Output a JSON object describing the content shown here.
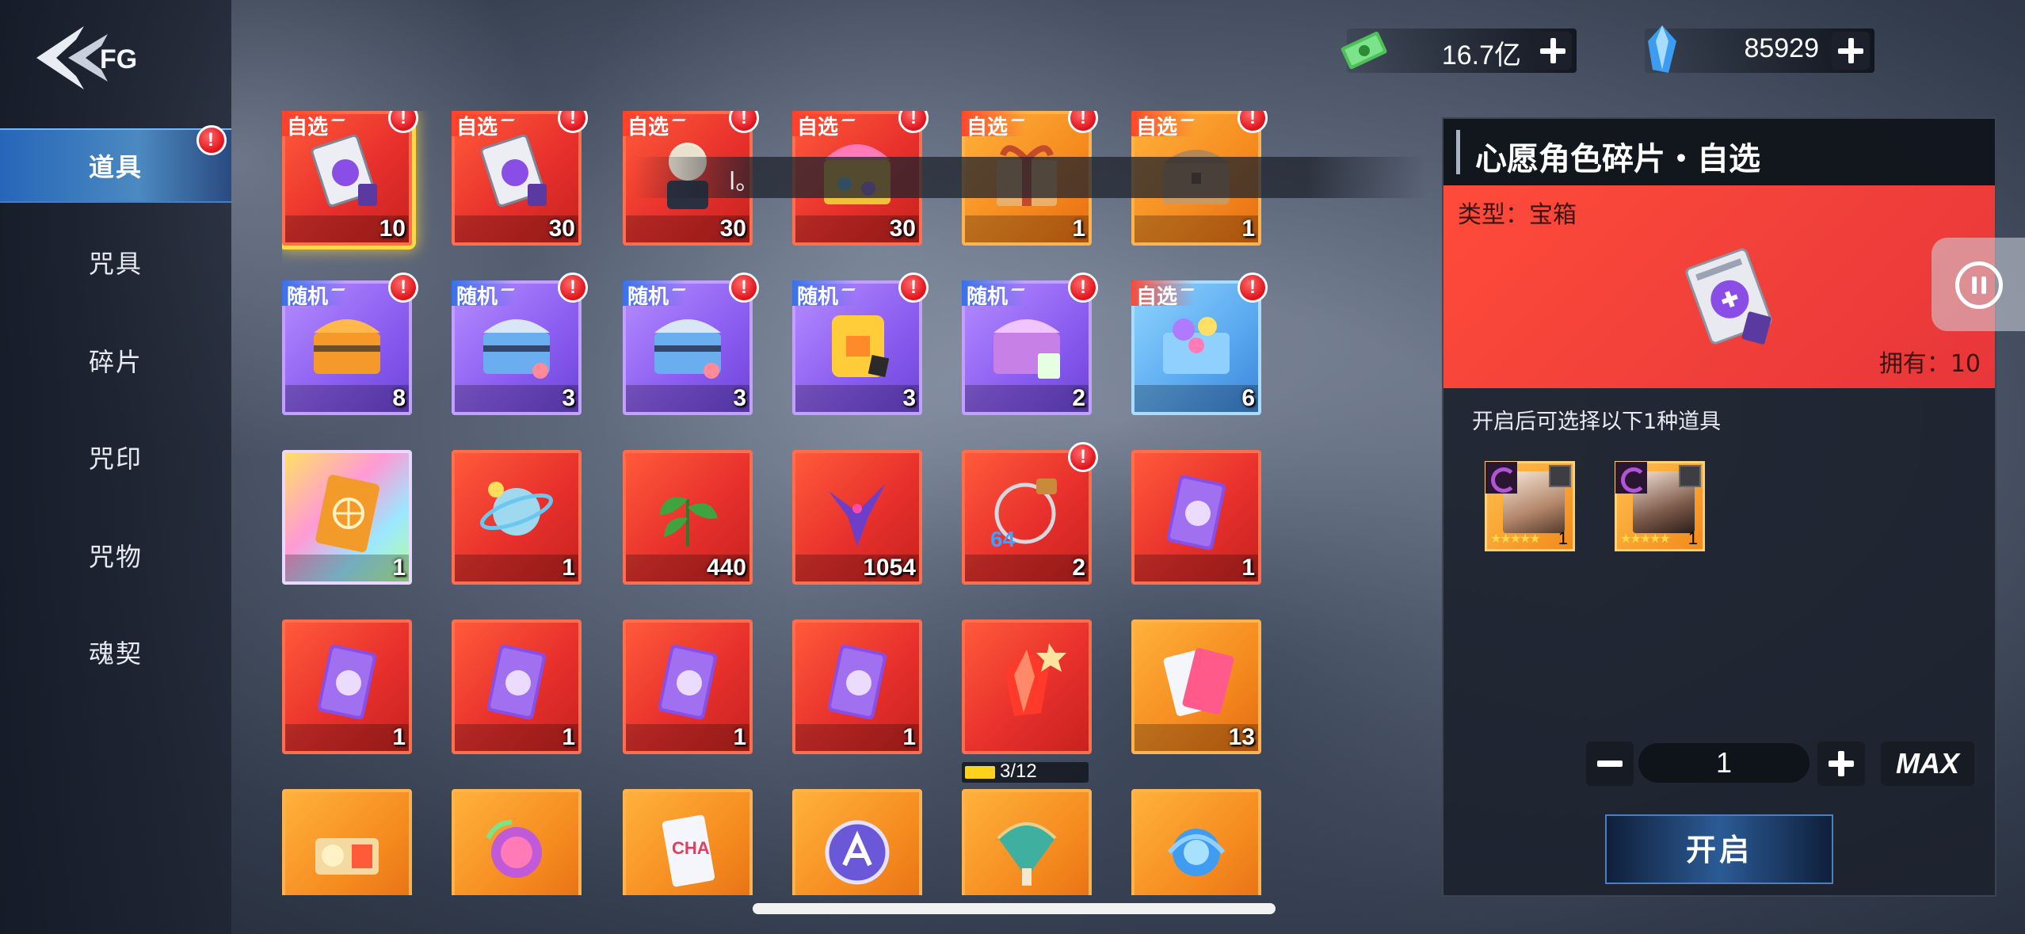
{
  "sidebar": {
    "items": [
      {
        "label": "道具",
        "active": true,
        "alert": "!"
      },
      {
        "label": "咒具"
      },
      {
        "label": "碎片"
      },
      {
        "label": "咒印"
      },
      {
        "label": "咒物"
      },
      {
        "label": "魂契"
      }
    ]
  },
  "currency": {
    "money": {
      "value": "16.7亿",
      "icon": "banknote-icon"
    },
    "crystal": {
      "value": "85929",
      "icon": "blue-crystal-icon"
    }
  },
  "notice": "l。",
  "items": [
    {
      "tag": "自选",
      "tag_kind": "choose",
      "count": "10",
      "color": "red",
      "icon": "shard-pack-icon",
      "alert": "!",
      "selected": true
    },
    {
      "tag": "自选",
      "tag_kind": "choose",
      "count": "30",
      "color": "red",
      "icon": "shard-pack-icon",
      "alert": "!"
    },
    {
      "tag": "自选",
      "tag_kind": "choose",
      "count": "30",
      "color": "red",
      "icon": "character-shard-icon",
      "alert": "!"
    },
    {
      "tag": "自选",
      "tag_kind": "choose",
      "count": "30",
      "color": "red",
      "icon": "treasure-chest-icon",
      "alert": "!"
    },
    {
      "tag": "自选",
      "tag_kind": "choose",
      "count": "1",
      "color": "orange",
      "icon": "gift-box-icon",
      "alert": "!"
    },
    {
      "tag": "自选",
      "tag_kind": "choose",
      "count": "1",
      "color": "orange",
      "icon": "chest-icon",
      "alert": "!"
    },
    {
      "tag": "随机",
      "tag_kind": "random",
      "count": "8",
      "color": "purple",
      "icon": "orange-chest-icon",
      "alert": "!"
    },
    {
      "tag": "随机",
      "tag_kind": "random",
      "count": "3",
      "color": "purple",
      "icon": "blue-chest-icon",
      "alert": "!"
    },
    {
      "tag": "随机",
      "tag_kind": "random",
      "count": "3",
      "color": "purple",
      "icon": "blue-chest-icon",
      "alert": "!"
    },
    {
      "tag": "随机",
      "tag_kind": "random",
      "count": "3",
      "color": "purple",
      "icon": "yellow-case-icon",
      "alert": "!"
    },
    {
      "tag": "随机",
      "tag_kind": "random",
      "count": "2",
      "color": "purple",
      "icon": "purple-chest-icon",
      "alert": "!"
    },
    {
      "tag": "自选",
      "tag_kind": "choose",
      "count": "6",
      "color": "blue",
      "icon": "toy-chest-icon",
      "alert": "!"
    },
    {
      "count": "1",
      "color": "rainbow",
      "icon": "golden-book-icon"
    },
    {
      "count": "1",
      "color": "red",
      "icon": "orb-icon"
    },
    {
      "count": "440",
      "color": "red",
      "icon": "leaf-icon"
    },
    {
      "count": "1054",
      "color": "red",
      "icon": "crow-icon"
    },
    {
      "count": "2",
      "color": "red",
      "icon": "bracelet-icon",
      "alert": "!"
    },
    {
      "count": "1",
      "color": "red",
      "icon": "purple-book-icon"
    },
    {
      "count": "1",
      "color": "red",
      "icon": "purple-book-icon"
    },
    {
      "count": "1",
      "color": "red",
      "icon": "purple-book-icon"
    },
    {
      "count": "1",
      "color": "red",
      "icon": "purple-book-icon"
    },
    {
      "count": "1",
      "color": "red",
      "icon": "purple-book-icon"
    },
    {
      "color": "red",
      "icon": "red-fragment-icon",
      "progress": {
        "text": "3/12",
        "value": 3,
        "max": 12
      }
    },
    {
      "count": "13",
      "color": "orange",
      "icon": "cards-icon"
    },
    {
      "color": "orange",
      "icon": "scroll-icon"
    },
    {
      "color": "orange",
      "icon": "spirit-orb-icon"
    },
    {
      "color": "orange",
      "icon": "chan-card-icon"
    },
    {
      "color": "orange",
      "icon": "emblem-icon"
    },
    {
      "color": "orange",
      "icon": "fan-icon"
    },
    {
      "color": "orange",
      "icon": "blue-orb-icon"
    }
  ],
  "detail": {
    "title": "心愿角色碎片・自选",
    "type_label": "类型：",
    "type_value": "宝箱",
    "owned_label": "拥有：",
    "owned_value": "10",
    "description": "开启后可选择以下1种道具",
    "rewards": [
      {
        "count": "1",
        "stars": "★★★★★",
        "icon": "character-portrait-icon"
      },
      {
        "count": "1",
        "stars": "★★★★★",
        "icon": "character-portrait-icon"
      }
    ],
    "quantity": "1",
    "max_label": "MAX",
    "open_label": "开启"
  },
  "colors": {
    "red_tile": "#e8302c",
    "orange_tile": "#f58a1f",
    "purple_tile": "#8a5cf0",
    "blue_tile": "#5aa8f0",
    "selected_border": "#ffd84a",
    "alert": "#e0121b"
  }
}
